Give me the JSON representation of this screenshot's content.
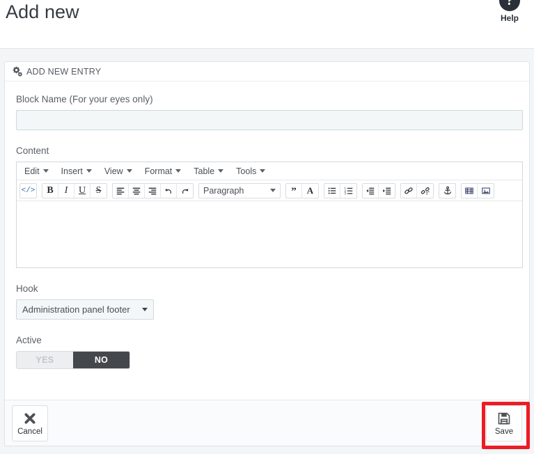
{
  "header": {
    "title": "Add new",
    "help_label": "Help",
    "help_icon": "question-mark-circle-icon"
  },
  "panel": {
    "head_icon": "cogs-icon",
    "head_title": "ADD NEW ENTRY"
  },
  "form": {
    "block_name": {
      "label": "Block Name (For your eyes only)",
      "value": "",
      "placeholder": ""
    },
    "content": {
      "label": "Content",
      "value": ""
    },
    "hook": {
      "label": "Hook",
      "selected": "Administration panel footer"
    },
    "active": {
      "label": "Active",
      "yes_label": "YES",
      "no_label": "NO",
      "selected": "NO"
    }
  },
  "editor": {
    "menus": [
      {
        "label": "Edit",
        "icon": "chevron-down-icon"
      },
      {
        "label": "Insert",
        "icon": "chevron-down-icon"
      },
      {
        "label": "View",
        "icon": "chevron-down-icon"
      },
      {
        "label": "Format",
        "icon": "chevron-down-icon"
      },
      {
        "label": "Table",
        "icon": "chevron-down-icon"
      },
      {
        "label": "Tools",
        "icon": "chevron-down-icon"
      }
    ],
    "format_select": {
      "value": "Paragraph",
      "icon": "chevron-down-icon"
    },
    "toolbar_groups": [
      {
        "buttons": [
          {
            "name": "source-code-icon",
            "glyph": "</>"
          }
        ]
      },
      {
        "buttons": [
          {
            "name": "bold-icon",
            "glyph": "B"
          },
          {
            "name": "italic-icon",
            "glyph": "I"
          },
          {
            "name": "underline-icon",
            "glyph": "U"
          },
          {
            "name": "strikethrough-icon",
            "glyph": "S"
          }
        ]
      },
      {
        "buttons": [
          {
            "name": "align-left-icon",
            "glyph": ""
          },
          {
            "name": "align-center-icon",
            "glyph": ""
          },
          {
            "name": "align-right-icon",
            "glyph": ""
          },
          {
            "name": "undo-icon",
            "glyph": ""
          },
          {
            "name": "redo-icon",
            "glyph": ""
          }
        ]
      },
      {
        "buttons": [
          {
            "name": "blockquote-icon",
            "glyph": "”"
          },
          {
            "name": "text-color-icon",
            "glyph": "A"
          }
        ]
      },
      {
        "buttons": [
          {
            "name": "bullet-list-icon",
            "glyph": ""
          },
          {
            "name": "numbered-list-icon",
            "glyph": ""
          }
        ]
      },
      {
        "buttons": [
          {
            "name": "outdent-icon",
            "glyph": ""
          },
          {
            "name": "indent-icon",
            "glyph": ""
          }
        ]
      },
      {
        "buttons": [
          {
            "name": "link-icon",
            "glyph": ""
          },
          {
            "name": "unlink-icon",
            "glyph": ""
          }
        ]
      },
      {
        "buttons": [
          {
            "name": "anchor-icon",
            "glyph": ""
          }
        ]
      },
      {
        "buttons": [
          {
            "name": "media-icon",
            "glyph": ""
          },
          {
            "name": "image-icon",
            "glyph": ""
          }
        ]
      }
    ]
  },
  "footer": {
    "cancel": {
      "label": "Cancel",
      "icon": "close-x-icon"
    },
    "save": {
      "label": "Save",
      "icon": "floppy-disk-save-icon"
    }
  },
  "annotation": {
    "target": "save-button",
    "color": "#ed1c24"
  }
}
